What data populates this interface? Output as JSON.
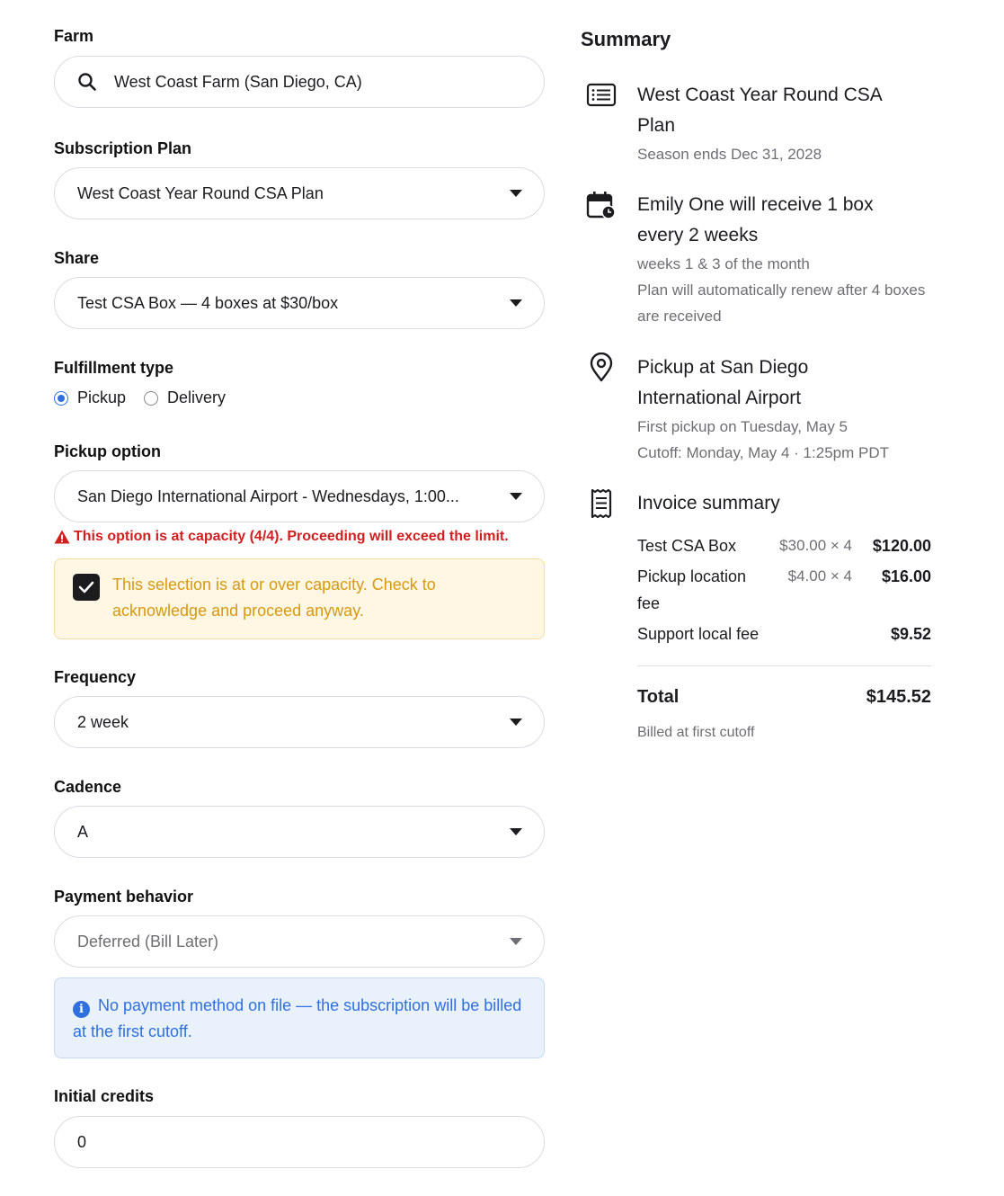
{
  "form": {
    "farm": {
      "label": "Farm",
      "value": "West Coast Farm (San Diego, CA)"
    },
    "subscription_plan": {
      "label": "Subscription Plan",
      "value": "West Coast Year Round CSA Plan"
    },
    "share": {
      "label": "Share",
      "value": "Test CSA Box — 4 boxes at $30/box"
    },
    "fulfillment": {
      "label": "Fulfillment type",
      "options": [
        "Pickup",
        "Delivery"
      ],
      "selected": "Pickup"
    },
    "pickup_option": {
      "label": "Pickup option",
      "value": "San Diego International Airport - Wednesdays, 1:00...",
      "warning": "This option is at capacity (4/4). Proceeding will exceed the limit.",
      "acknowledge_text": "This selection is at or over capacity. Check to acknowledge and proceed anyway.",
      "acknowledged": true
    },
    "frequency": {
      "label": "Frequency",
      "value": "2 week"
    },
    "cadence": {
      "label": "Cadence",
      "value": "A"
    },
    "payment_behavior": {
      "label": "Payment behavior",
      "value": "Deferred (Bill Later)",
      "info": "No payment method on file — the subscription will be billed at the first cutoff."
    },
    "initial_credits": {
      "label": "Initial credits",
      "value": "0"
    }
  },
  "summary": {
    "title": "Summary",
    "plan": {
      "heading": "West Coast Year Round CSA Plan",
      "sub": "Season ends Dec 31, 2028"
    },
    "schedule": {
      "heading": "Emily One will receive 1 box every 2 weeks",
      "sub1": "weeks 1 & 3 of the month",
      "sub2": "Plan will automatically renew after 4 boxes are received"
    },
    "pickup": {
      "heading": "Pickup at San Diego International Airport",
      "sub1": "First pickup on Tuesday, May 5",
      "sub2": "Cutoff: Monday, May 4 · 1:25pm PDT"
    },
    "invoice": {
      "heading": "Invoice summary",
      "rows": [
        {
          "name": "Test CSA Box",
          "qty": "$30.00 × 4",
          "amount": "$120.00"
        },
        {
          "name": "Pickup location fee",
          "qty": "$4.00 × 4",
          "amount": "$16.00"
        },
        {
          "name": "Support local fee",
          "qty": "",
          "amount": "$9.52"
        }
      ],
      "total_label": "Total",
      "total": "$145.52",
      "billed_note": "Billed at first cutoff"
    }
  },
  "colors": {
    "accent": "#2f6fde",
    "warning": "#d11f1f",
    "ack_text": "#d49a12"
  }
}
